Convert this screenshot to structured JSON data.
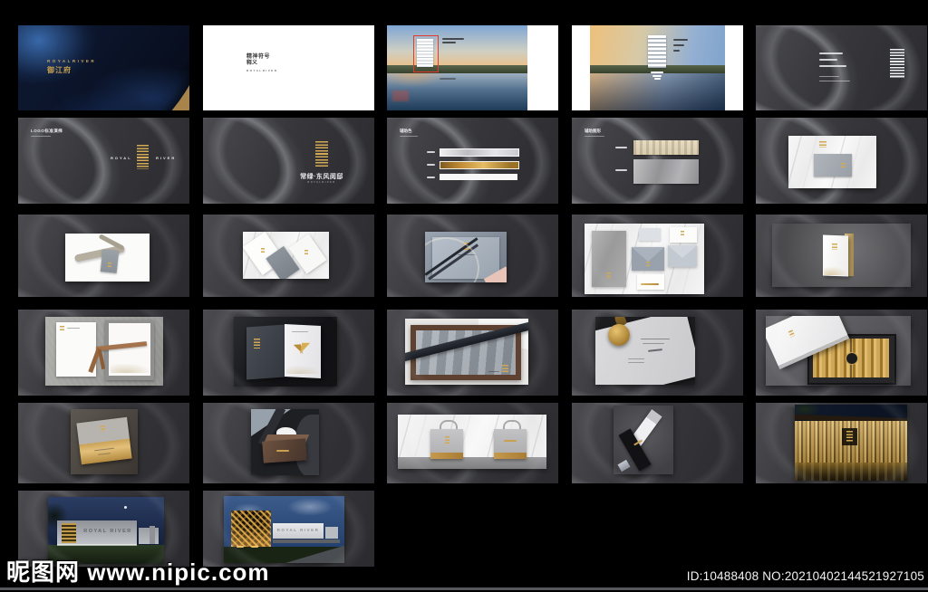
{
  "watermark": {
    "site_name": "昵图网",
    "site_url": "www.nipic.com"
  },
  "footer": {
    "id_text": "ID:10488408 NO:20210402144521927105"
  },
  "palette": {
    "gold": "#c9a050",
    "slide_background": "#39393d",
    "cover_navy": "#0c1830",
    "accent_red": "#e5392e",
    "swatch_silver": "#d3d3d6",
    "swatch_gold": "#c59245",
    "swatch_white": "#f7f7f7"
  },
  "deck": {
    "brand_caps": "ROYALRIVER",
    "brand_left": "ROYAL",
    "brand_right": "RIVER",
    "cover_project": "御江府",
    "definition_line1": "精神符号",
    "definition_line2": "释义",
    "logo_slide_title": "LOGO标准演绎",
    "lockup_project": "常绿·东风阅邸",
    "aux_color_title": "辅助色",
    "aux_graphic_title": "辅助图形",
    "signage_text": "ROYAL RIVER"
  }
}
